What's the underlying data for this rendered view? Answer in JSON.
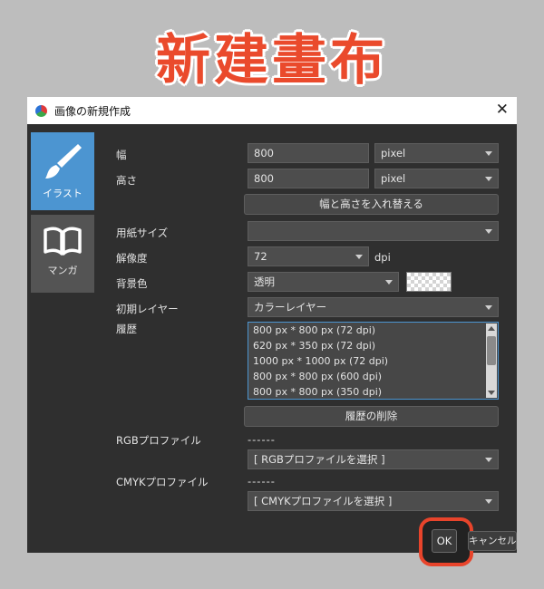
{
  "banner": "新建畫布",
  "window": {
    "title": "画像の新規作成",
    "close_glyph": "✕"
  },
  "tabs": [
    {
      "label": "イラスト",
      "icon": "brush-icon",
      "active": true
    },
    {
      "label": "マンガ",
      "icon": "book-icon",
      "active": false
    }
  ],
  "form": {
    "width_label": "幅",
    "width_value": "800",
    "width_unit": "pixel",
    "height_label": "高さ",
    "height_value": "800",
    "height_unit": "pixel",
    "swap_button": "幅と高さを入れ替える",
    "paper_size_label": "用紙サイズ",
    "paper_size_value": "",
    "resolution_label": "解像度",
    "resolution_value": "72",
    "resolution_unit": "dpi",
    "bg_color_label": "背景色",
    "bg_color_value": "透明",
    "initial_layer_label": "初期レイヤー",
    "initial_layer_value": "カラーレイヤー",
    "history_label": "履歴",
    "history_items": [
      "800 px * 800 px (72 dpi)",
      "620 px * 350 px (72 dpi)",
      "1000 px * 1000 px (72 dpi)",
      "800 px * 800 px (600 dpi)",
      "800 px * 800 px (350 dpi)"
    ],
    "clear_history_button": "履歴の削除",
    "rgb_profile_label": "RGBプロファイル",
    "rgb_profile_dashes": "------",
    "rgb_profile_value": "[ RGBプロファイルを選択 ]",
    "cmyk_profile_label": "CMYKプロファイル",
    "cmyk_profile_dashes": "------",
    "cmyk_profile_value": "[ CMYKプロファイルを選択 ]"
  },
  "footer": {
    "ok_button": "OK",
    "cancel_button": "キャンセル"
  },
  "colors": {
    "accent": "#4c95d1",
    "highlight": "#e8442b",
    "banner": "#ea4a2c"
  }
}
